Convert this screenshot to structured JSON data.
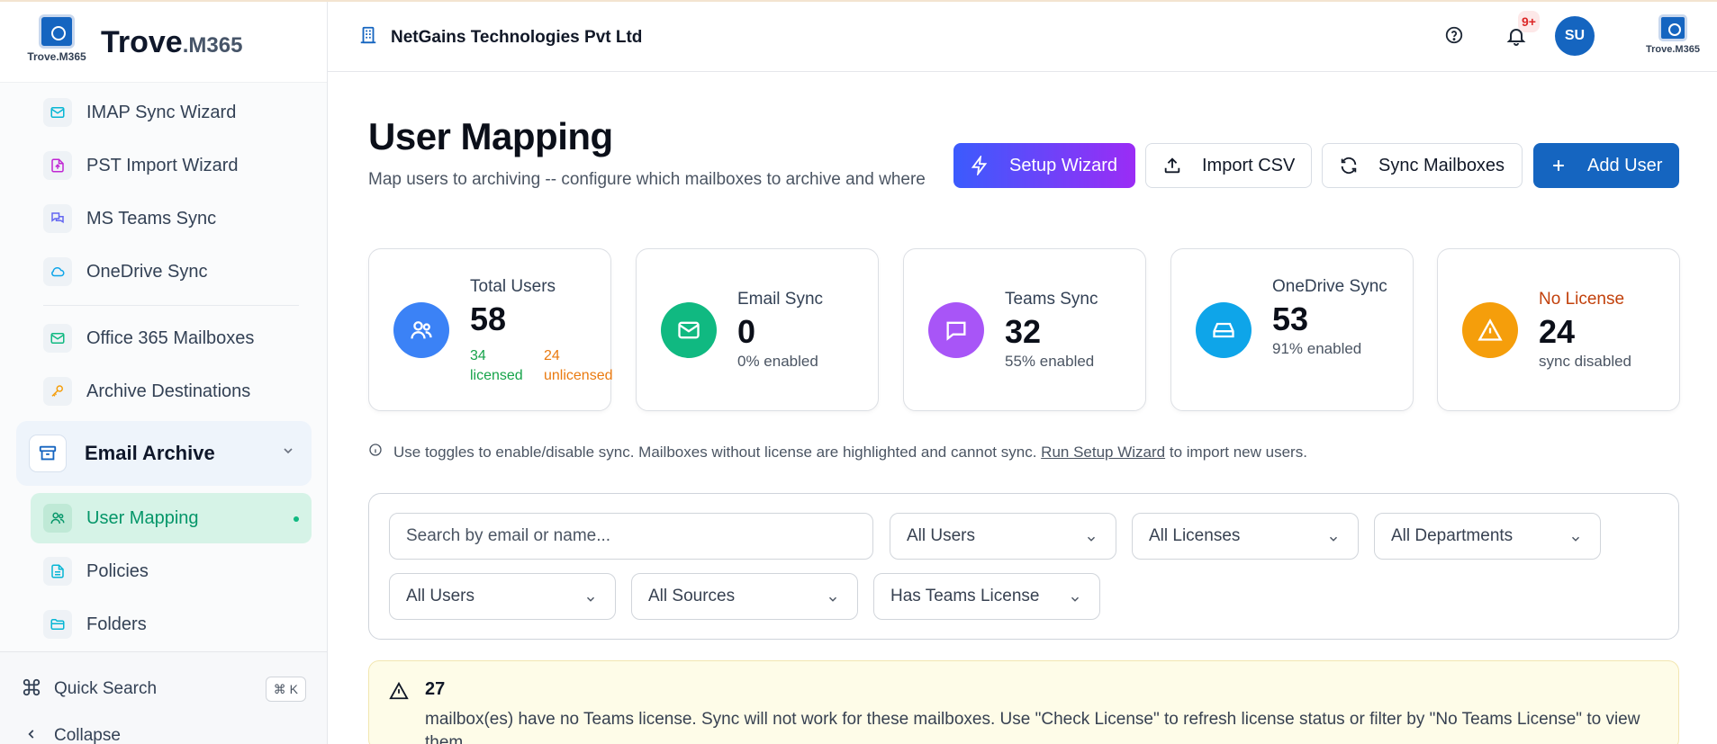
{
  "brand": {
    "logo_text": "Trove.M365",
    "name": "Trove",
    "name_suffix": ".M365"
  },
  "sidebar": {
    "items": [
      {
        "label": "IMAP Sync Wizard",
        "icon": "mail-icon"
      },
      {
        "label": "PST Import Wizard",
        "icon": "file-upload-icon"
      },
      {
        "label": "MS Teams Sync",
        "icon": "chat-icon"
      },
      {
        "label": "OneDrive Sync",
        "icon": "cloud-icon"
      },
      {
        "label": "Office 365 Mailboxes",
        "icon": "mail-icon"
      },
      {
        "label": "Archive Destinations",
        "icon": "key-icon"
      }
    ],
    "group": {
      "label": "Email Archive",
      "icon": "archive-icon"
    },
    "sub_items": [
      {
        "label": "User Mapping",
        "icon": "users-icon",
        "active": true
      },
      {
        "label": "Policies",
        "icon": "document-icon"
      },
      {
        "label": "Folders",
        "icon": "folder-icon"
      }
    ],
    "quick_search": {
      "label": "Quick Search",
      "shortcut": "⌘ K"
    },
    "collapse_label": "Collapse"
  },
  "header": {
    "org_name": "NetGains Technologies Pvt Ltd",
    "notification_badge": "9+",
    "avatar_initials": "SU",
    "logo_text": "Trove.M365"
  },
  "page": {
    "title": "User Mapping",
    "subtitle": "Map users to archiving -- configure which mailboxes to archive and where"
  },
  "actions": {
    "setup_wizard": "Setup Wizard",
    "import_csv": "Import CSV",
    "sync_mailboxes": "Sync Mailboxes",
    "add_user": "Add User"
  },
  "stats": {
    "total_users": {
      "label": "Total Users",
      "value": "58",
      "licensed": "34 licensed",
      "unlicensed": "24 unlicensed"
    },
    "email_sync": {
      "label": "Email Sync",
      "value": "0",
      "sub": "0% enabled"
    },
    "teams_sync": {
      "label": "Teams Sync",
      "value": "32",
      "sub": "55% enabled"
    },
    "onedrive_sync": {
      "label": "OneDrive Sync",
      "value": "53",
      "sub": "91% enabled"
    },
    "no_license": {
      "label": "No License",
      "value": "24",
      "sub": "sync disabled"
    }
  },
  "info": {
    "text_before": "Use toggles to enable/disable sync. Mailboxes without license are highlighted and cannot sync.",
    "link": "Run Setup Wizard",
    "text_after": "to import new users."
  },
  "filters": {
    "search_placeholder": "Search by email or name...",
    "user_filter": "All Users",
    "license_filter": "All Licenses",
    "department_filter": "All Departments",
    "user_filter_2": "All Users",
    "source_filter": "All Sources",
    "teams_license_filter": "Has Teams License"
  },
  "warning": {
    "count": "27",
    "message": "mailbox(es) have no Teams license. Sync will not work for these mailboxes. Use \"Check License\" to refresh license status or filter by \"No Teams License\" to view them."
  },
  "colors": {
    "primary": "#1565c0",
    "success": "#10b981",
    "warning": "#f59e0b",
    "purple": "#a855f7",
    "sky": "#0ea5e9",
    "blue": "#3b82f6"
  }
}
